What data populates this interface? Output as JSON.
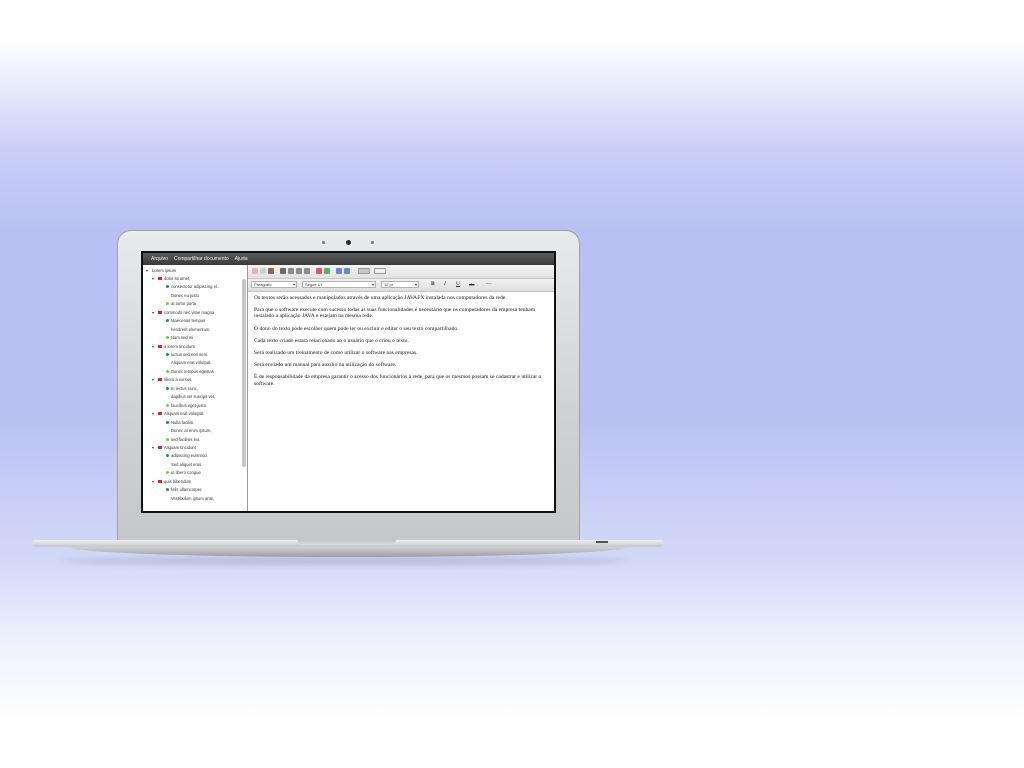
{
  "menubar": {
    "items": [
      "Arquivo",
      "Compartilhar documento",
      "Ajuda"
    ]
  },
  "tree": {
    "items": [
      {
        "label": "Lorem ipsum",
        "level": 0,
        "marker": "none"
      },
      {
        "label": "dolor sit amet,",
        "level": 1,
        "marker": "red"
      },
      {
        "label": "consectetur adipiscing el..",
        "level": 2,
        "marker": "teal"
      },
      {
        "label": "Donec eu justo",
        "level": 2,
        "marker": "none"
      },
      {
        "label": "at tortor porta",
        "level": 2,
        "marker": "green"
      },
      {
        "label": "commodo nec vitae magna",
        "level": 1,
        "marker": "red"
      },
      {
        "label": "Maecenas tempus",
        "level": 2,
        "marker": "teal"
      },
      {
        "label": "hendrerit elementum.",
        "level": 2,
        "marker": "none"
      },
      {
        "label": "Nam sed mi",
        "level": 2,
        "marker": "green"
      },
      {
        "label": "a lorem tincidunt",
        "level": 1,
        "marker": "red"
      },
      {
        "label": "luctus sed non sem.",
        "level": 2,
        "marker": "teal"
      },
      {
        "label": "Aliquam erat volutpat.",
        "level": 2,
        "marker": "none"
      },
      {
        "label": "Donec tempus egestas",
        "level": 2,
        "marker": "green"
      },
      {
        "label": "libero a cursus.",
        "level": 1,
        "marker": "red"
      },
      {
        "label": "In lectus nunc,",
        "level": 2,
        "marker": "teal"
      },
      {
        "label": "dapibus vel suscipit vel,",
        "level": 2,
        "marker": "none"
      },
      {
        "label": "faucibus eget justo.",
        "level": 2,
        "marker": "green"
      },
      {
        "label": "Aliquam erat volutpat.",
        "level": 1,
        "marker": "red"
      },
      {
        "label": "Nulla facilisi.",
        "level": 2,
        "marker": "teal"
      },
      {
        "label": "Donec at enim ipsum,",
        "level": 2,
        "marker": "none"
      },
      {
        "label": "sed facilisis leo.",
        "level": 2,
        "marker": "green"
      },
      {
        "label": "Aliquam tincidunt",
        "level": 1,
        "marker": "red"
      },
      {
        "label": "adipiscing euismod.",
        "level": 2,
        "marker": "teal"
      },
      {
        "label": "Sed aliquet eros",
        "level": 2,
        "marker": "none"
      },
      {
        "label": "ut libero congue",
        "level": 2,
        "marker": "green"
      },
      {
        "label": "quis bibendum",
        "level": 1,
        "marker": "red"
      },
      {
        "label": "felis ullamcorper.",
        "level": 2,
        "marker": "teal"
      },
      {
        "label": "Vestibulum ipsum ante,",
        "level": 2,
        "marker": "none"
      }
    ]
  },
  "toolbar": {
    "paragraph_style": "Parágrafo",
    "font_family": "Segoe UI",
    "font_size": "12 pt",
    "bold": "B",
    "italic": "I",
    "underline": "U",
    "strike": "abc",
    "hr": "—"
  },
  "document": {
    "paragraphs": [
      "Os textos serão acessados e manipulados através de uma aplicação JAVAFX instalada nos computadores da rede.",
      "Para que o software execute com sucesso todas as suas funcionalidades é necessário que os computadores da empresa tenham instalado a aplicação JAVA e estejam na mesma rede.",
      "O dono do texto pode escolher quem pode ler ou excluir e editar o seu texto compartilhado.",
      "Cada texto criado estará relacionado ao o usuário que o criou o texto.",
      "Será realizado um treinamento de como utilizar o software nas empresas.",
      "Será enviado um manual para auxílio na utilização do software.",
      "É de responsabilidade da empresa garantir o acesso dos funcionários à rede, para que os mesmos possam se cadastrar e utilizar o software."
    ]
  },
  "colors": {
    "red": "#d42a2a",
    "teal": "#1a8a8a",
    "green": "#7fcf2a"
  }
}
